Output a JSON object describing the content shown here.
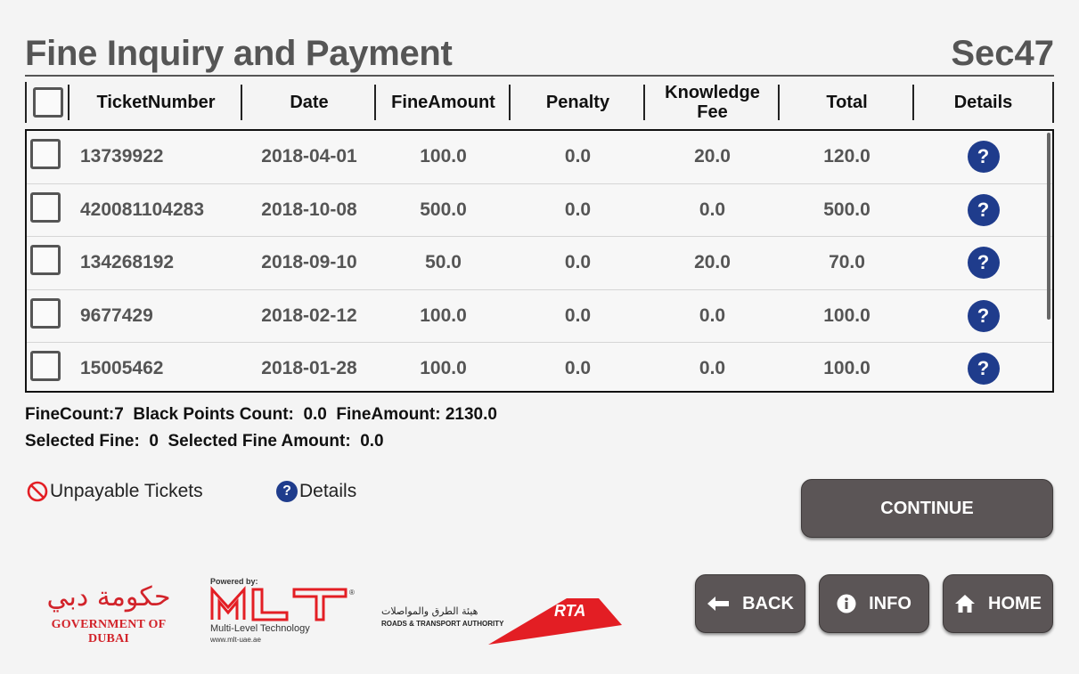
{
  "header": {
    "title": "Fine Inquiry and Payment",
    "code": "Sec47"
  },
  "table": {
    "columns": [
      "TicketNumber",
      "Date",
      "FineAmount",
      "Penalty",
      "Knowledge Fee",
      "Total",
      "Details"
    ],
    "rows": [
      [
        "13739922",
        "2018-04-01",
        "100.0",
        "0.0",
        "20.0",
        "120.0"
      ],
      [
        "420081104283",
        "2018-10-08",
        "500.0",
        "0.0",
        "0.0",
        "500.0"
      ],
      [
        "134268192",
        "2018-09-10",
        "50.0",
        "0.0",
        "20.0",
        "70.0"
      ],
      [
        "9677429",
        "2018-02-12",
        "100.0",
        "0.0",
        "0.0",
        "100.0"
      ],
      [
        "15005462",
        "2018-01-28",
        "100.0",
        "0.0",
        "0.0",
        "100.0"
      ]
    ],
    "details_glyph": "?"
  },
  "summary": {
    "line1": "FineCount:7  Black Points Count:  0.0  FineAmount: 2130.0",
    "line2": "Selected Fine:  0  Selected Fine Amount:  0.0"
  },
  "legend": {
    "unpayable": "Unpayable Tickets",
    "details": "Details"
  },
  "buttons": {
    "continue": "CONTINUE",
    "back": "BACK",
    "info": "INFO",
    "home": "HOME"
  },
  "logos": {
    "dubai_arabic": "حكومة دبي",
    "dubai_english": "GOVERNMENT OF DUBAI",
    "mlt_powered": "Powered by:",
    "mlt_name": "Multi-Level Technology",
    "mlt_url": "www.mlt-uae.ae",
    "rta_arabic": "هيئة الطرق والمواصلات",
    "rta_english": "ROADS & TRANSPORT AUTHORITY",
    "rta_mark": "RTA"
  },
  "colors": {
    "accent_blue": "#1f3c8c",
    "button": "#5b5556",
    "logo_red": "#e31e24"
  }
}
